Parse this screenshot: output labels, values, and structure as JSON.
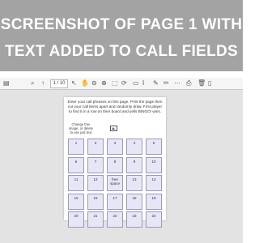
{
  "headline": {
    "line1": "SCREENSHOT OF PAGE 1 WITH",
    "line2": "TEXT ADDED TO CALL FIELDS"
  },
  "toolbar": {
    "page_number": "1 / 10",
    "icons": [
      "sidebar-icon",
      "zoom-out-icon",
      "zoom-in-icon",
      "page-up-icon",
      "page-down-icon",
      "select-icon",
      "hand-icon",
      "rotate-icon",
      "fit-icon",
      "search-icon",
      "comment-icon",
      "highlight-icon",
      "draw-icon",
      "text-icon",
      "print-icon",
      "delete-icon",
      "more-icon"
    ]
  },
  "page": {
    "instructions": "Enter your call phrases on this page. Print the page then cut your call items apart and randomly draw. First player to find 5 in a row on their board and yells BINGO! wins.",
    "image_note": "Change free image, or delete to use just text",
    "grid": [
      [
        "1",
        "2",
        "3",
        "4",
        "5"
      ],
      [
        "6",
        "7",
        "8",
        "9",
        "10"
      ],
      [
        "11",
        "12",
        "free space",
        "13",
        "14"
      ],
      [
        "15",
        "16",
        "17",
        "18",
        "19"
      ],
      [
        "20",
        "21",
        "22",
        "23",
        "24"
      ]
    ]
  },
  "colors": {
    "banner": "#a3a3a3",
    "cell_fill": "#e6e6f7",
    "cell_border": "#9a9aba"
  }
}
